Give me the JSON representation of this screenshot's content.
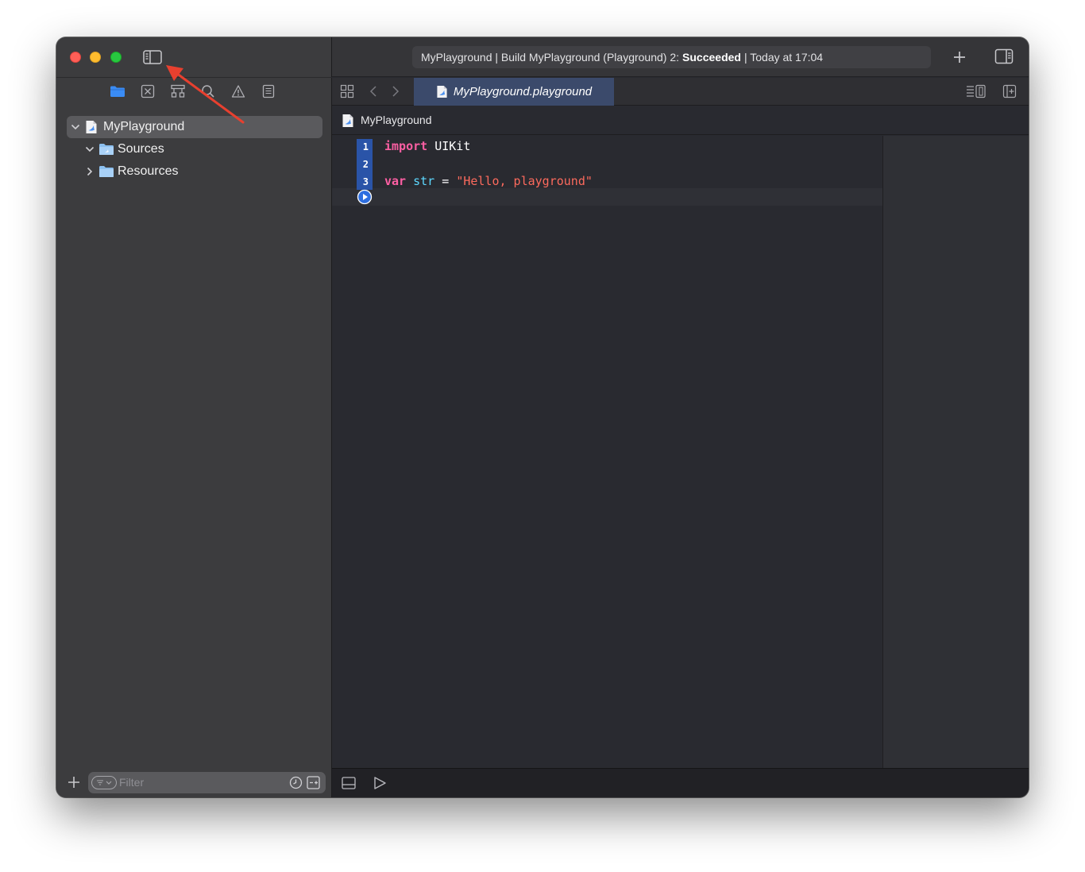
{
  "window": {
    "activity": {
      "prefix": "MyPlayground | Build MyPlayground (Playground) 2:",
      "status": "Succeeded",
      "suffix": "| Today at 17:04"
    }
  },
  "editor_tab": {
    "label": "MyPlayground.playground"
  },
  "jump_bar": {
    "label": "MyPlayground"
  },
  "navigator": {
    "tabs": [
      "folder-icon",
      "source-control-icon",
      "symbol-icon",
      "find-icon",
      "issue-icon",
      "report-icon"
    ],
    "tree": [
      {
        "label": "MyPlayground",
        "expanded": true,
        "selected": true
      },
      {
        "label": "Sources",
        "expanded": true
      },
      {
        "label": "Resources",
        "expanded": false
      }
    ],
    "filter": {
      "placeholder": "Filter"
    }
  },
  "code": {
    "line_numbers": [
      "1",
      "2",
      "3"
    ],
    "line1": {
      "keyword": "import",
      "name": "UIKit"
    },
    "line3": {
      "keyword": "var",
      "name": "str",
      "op": "=",
      "string": "\"Hello, playground\""
    }
  },
  "colors": {
    "accent": "#2a54a8",
    "tab_selected": "#3b4a6b",
    "keyword": "#fc5fa3",
    "string": "#fc6a5d",
    "variable": "#5dd8ff",
    "annotation_arrow": "#e8402f"
  }
}
